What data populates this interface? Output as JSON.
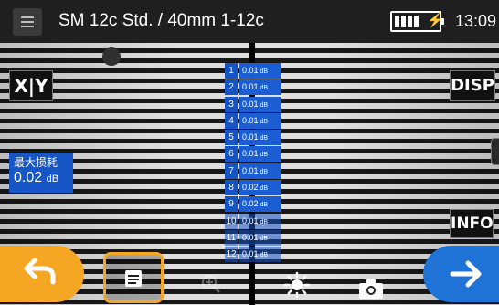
{
  "topbar": {
    "title": "SM 12c Std. / 40mm 1-12c",
    "battery_icon": "battery-full-icon",
    "charging_symbol": "⚡",
    "time": "13:09"
  },
  "side_buttons": {
    "xy_label": "X|Y",
    "disp_label": "DISP",
    "info_label": "INFO"
  },
  "max_loss": {
    "label": "最大损耗",
    "value": "0.02",
    "unit": "dB"
  },
  "loss_list": [
    {
      "fiber": "1",
      "value": "0.01",
      "unit": "dB"
    },
    {
      "fiber": "2",
      "value": "0.01",
      "unit": "dB"
    },
    {
      "fiber": "3",
      "value": "0.01",
      "unit": "dB"
    },
    {
      "fiber": "4",
      "value": "0.01",
      "unit": "dB"
    },
    {
      "fiber": "5",
      "value": "0.01",
      "unit": "dB"
    },
    {
      "fiber": "6",
      "value": "0.01",
      "unit": "dB"
    },
    {
      "fiber": "7",
      "value": "0.01",
      "unit": "dB"
    },
    {
      "fiber": "8",
      "value": "0.02",
      "unit": "dB"
    },
    {
      "fiber": "9",
      "value": "0.02",
      "unit": "dB"
    },
    {
      "fiber": "10",
      "value": "0.01",
      "unit": "dB"
    },
    {
      "fiber": "11",
      "value": "0.01",
      "unit": "dB"
    },
    {
      "fiber": "12",
      "value": "0.01",
      "unit": "dB"
    }
  ],
  "bottom_bar": {
    "back_icon": "back-arrow-icon",
    "notes_icon": "notes-icon",
    "zoom_icon": "zoom-in-icon",
    "brightness_icon": "brightness-icon",
    "camera_icon": "camera-icon",
    "next_icon": "next-arrow-icon"
  },
  "colors": {
    "accent_orange": "#f5a623",
    "accent_blue": "#1f73d6",
    "loss_blue": "#1b5ed3"
  }
}
